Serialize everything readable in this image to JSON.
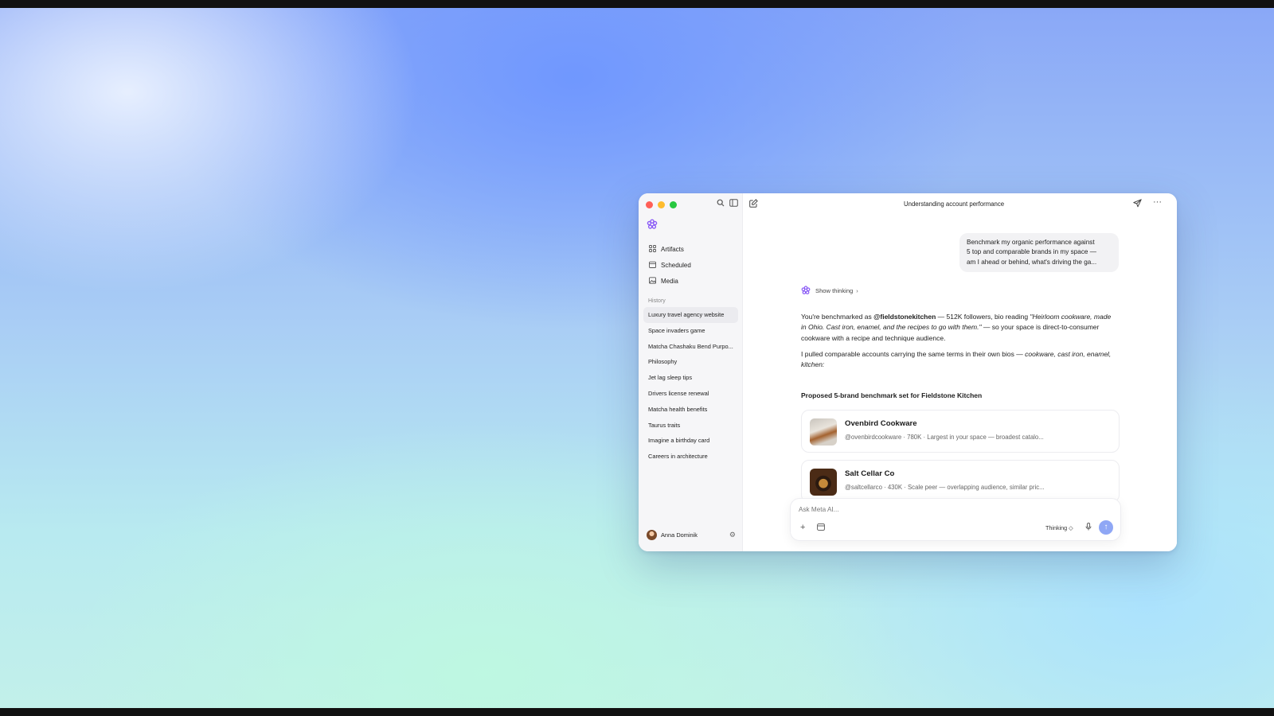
{
  "window": {
    "title": "Understanding account performance"
  },
  "sidebar": {
    "nav": [
      {
        "label": "Artifacts",
        "icon": "artifacts-icon"
      },
      {
        "label": "Scheduled",
        "icon": "calendar-icon"
      },
      {
        "label": "Media",
        "icon": "media-icon"
      }
    ],
    "history_label": "History",
    "history": [
      "Luxury travel agency website",
      "Space invaders game",
      "Matcha Chashaku Bend Purpo...",
      "Philosophy",
      "Jet lag sleep tips",
      "Drivers license renewal",
      "Matcha health benefits",
      "Taurus traits",
      "Imagine a birthday card",
      "Careers in architecture"
    ],
    "user_name": "Anna Dominik"
  },
  "chat": {
    "user_message": [
      "Benchmark my organic performance against",
      "5 top and comparable brands in my space —",
      "am I ahead or behind, what's driving the ga..."
    ],
    "show_thinking": "Show thinking",
    "answer_p1": {
      "t1": "You're benchmarked as ",
      "handle": "@fieldstonekitchen",
      "t2": " — 512K followers, bio reading ",
      "quote": "\"Heirloom cookware, made in Ohio. Cast iron, enamel, and the recipes to go with them.\"",
      "t3": " — so your space is direct-to-consumer cookware with a recipe and technique audience."
    },
    "answer_p2": {
      "t1": "I pulled comparable accounts carrying the same terms in their own bios — ",
      "terms": "cookware, cast iron, enamel, kitchen:"
    },
    "section_title": "Proposed 5-brand benchmark set for Fieldstone Kitchen",
    "brands": [
      {
        "name": "Ovenbird Cookware",
        "detail": "@ovenbirdcookware · 780K · Largest in your space — broadest catalo..."
      },
      {
        "name": "Salt Cellar Co",
        "detail": "@saltcellarco · 430K · Scale peer — overlapping audience, similar pric..."
      }
    ]
  },
  "composer": {
    "placeholder": "Ask Meta AI...",
    "mode": "Thinking ◇"
  },
  "colors": {
    "send_button": "#8fa7f5",
    "brand_purple": "#8b5cf6",
    "close": "#ff5f57",
    "minimize": "#febc2e",
    "zoom": "#28c840"
  }
}
